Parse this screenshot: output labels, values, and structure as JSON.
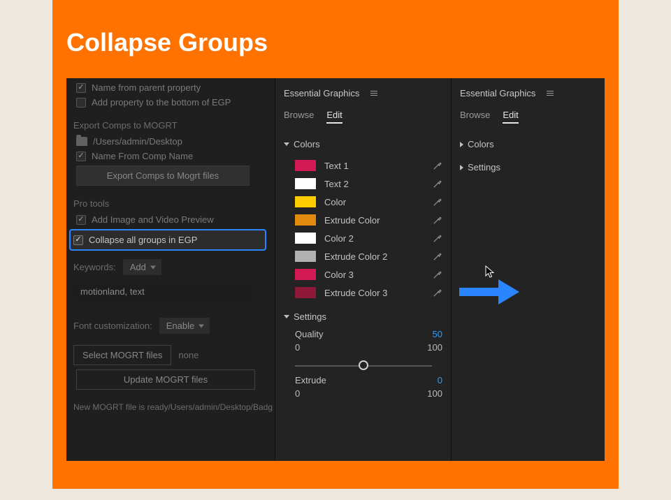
{
  "title": "Collapse Groups",
  "left": {
    "name_from_parent": "Name from parent property",
    "add_property": "Add property to the bottom of EGP",
    "export_heading": "Export Comps to MOGRT",
    "export_path": "/Users/admin/Desktop",
    "name_from_comp": "Name From Comp Name",
    "export_btn": "Export Comps to Mogrt files",
    "pro_heading": "Pro tools",
    "add_preview": "Add Image and Video Preview",
    "collapse_all": "Collapse all groups in EGP",
    "keywords_label": "Keywords:",
    "keywords_add": "Add",
    "keywords_value": "motionland, text",
    "font_label": "Font customization:",
    "font_value": "Enable",
    "select_mogrt": "Select MOGRT files",
    "none": "none",
    "update_mogrt": "Update MOGRT files",
    "status": "New MOGRT file is ready/Users/admin/Desktop/Badg"
  },
  "mid": {
    "panel_title": "Essential Graphics",
    "tab_browse": "Browse",
    "tab_edit": "Edit",
    "colors_label": "Colors",
    "colors": [
      {
        "label": "Text 1",
        "hex": "#d41a55"
      },
      {
        "label": "Text 2",
        "hex": "#ffffff"
      },
      {
        "label": "Color",
        "hex": "#ffcc00"
      },
      {
        "label": "Extrude Color",
        "hex": "#e28a0e"
      },
      {
        "label": "Color 2",
        "hex": "#ffffff"
      },
      {
        "label": "Extrude Color 2",
        "hex": "#b1b1b1"
      },
      {
        "label": "Color 3",
        "hex": "#d41a55"
      },
      {
        "label": "Extrude Color 3",
        "hex": "#8e1837"
      }
    ],
    "settings_label": "Settings",
    "quality_label": "Quality",
    "quality_value": "50",
    "range_min": "0",
    "range_max": "100",
    "extrude_label": "Extrude",
    "extrude_value": "0"
  },
  "right": {
    "panel_title": "Essential Graphics",
    "tab_browse": "Browse",
    "tab_edit": "Edit",
    "colors_label": "Colors",
    "settings_label": "Settings"
  }
}
